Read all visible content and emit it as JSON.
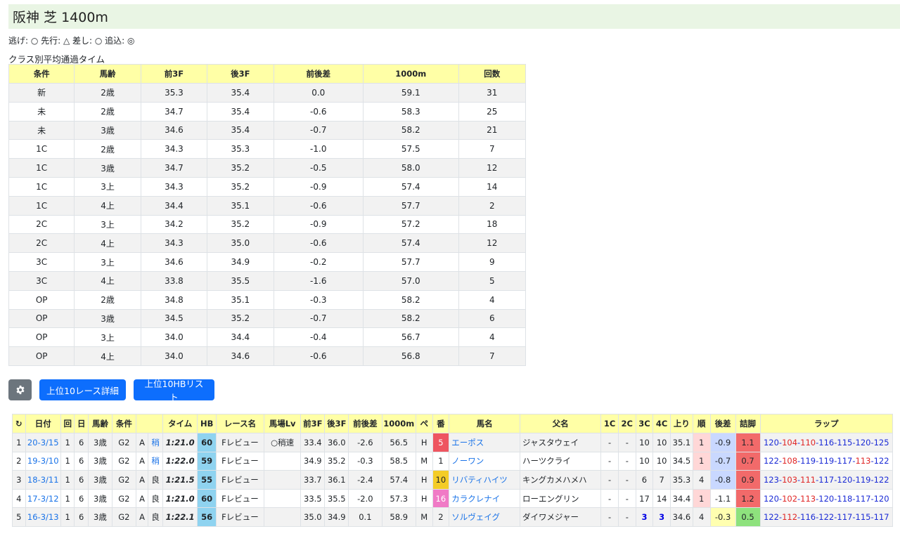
{
  "title": "阪神 芝 1400m",
  "legend": "逃げ: ○ 先行: △ 差し: ○ 追込: ◎",
  "caption": "クラス別平均通過タイム",
  "avg_table": {
    "headers": [
      "条件",
      "馬齢",
      "前3F",
      "後3F",
      "前後差",
      "1000m",
      "回数"
    ],
    "rows": [
      [
        "新",
        "2歳",
        "35.3",
        "35.4",
        "0.0",
        "59.1",
        "31"
      ],
      [
        "未",
        "2歳",
        "34.7",
        "35.4",
        "-0.6",
        "58.3",
        "25"
      ],
      [
        "未",
        "3歳",
        "34.6",
        "35.4",
        "-0.7",
        "58.2",
        "21"
      ],
      [
        "1C",
        "2歳",
        "34.3",
        "35.3",
        "-1.0",
        "57.5",
        "7"
      ],
      [
        "1C",
        "3歳",
        "34.7",
        "35.2",
        "-0.5",
        "58.0",
        "12"
      ],
      [
        "1C",
        "3上",
        "34.3",
        "35.2",
        "-0.9",
        "57.4",
        "14"
      ],
      [
        "1C",
        "4上",
        "34.4",
        "35.1",
        "-0.6",
        "57.7",
        "2"
      ],
      [
        "2C",
        "3上",
        "34.2",
        "35.2",
        "-0.9",
        "57.2",
        "18"
      ],
      [
        "2C",
        "4上",
        "34.3",
        "35.0",
        "-0.6",
        "57.4",
        "12"
      ],
      [
        "3C",
        "3上",
        "34.6",
        "34.9",
        "-0.2",
        "57.7",
        "9"
      ],
      [
        "3C",
        "4上",
        "33.8",
        "35.5",
        "-1.6",
        "57.0",
        "5"
      ],
      [
        "OP",
        "2歳",
        "34.8",
        "35.1",
        "-0.3",
        "58.2",
        "4"
      ],
      [
        "OP",
        "3歳",
        "34.5",
        "35.2",
        "-0.7",
        "58.2",
        "6"
      ],
      [
        "OP",
        "3上",
        "34.0",
        "34.4",
        "-0.4",
        "56.7",
        "4"
      ],
      [
        "OP",
        "4上",
        "34.0",
        "34.6",
        "-0.6",
        "56.8",
        "7"
      ]
    ]
  },
  "buttons": {
    "gear_icon": "gear-icon",
    "detail": "上位10レース詳細",
    "hb_list": "上位10HBリスト"
  },
  "race_table": {
    "refresh_icon": "↻",
    "headers": [
      "日付",
      "回",
      "日",
      "馬齢",
      "条件",
      "",
      "タイム",
      "HB",
      "レース名",
      "馬場Lv",
      "前3F",
      "後3F",
      "前後差",
      "1000m",
      "ペ",
      "番",
      "馬名",
      "父名",
      "1C",
      "2C",
      "3C",
      "4C",
      "上り",
      "順",
      "後差",
      "詰脚",
      "ラップ"
    ],
    "rows": [
      {
        "no": "1",
        "date": "20-3/15",
        "kai": "1",
        "nichi": "6",
        "age": "3歳",
        "cond": "G2",
        "grade": "A",
        "baba": "稍",
        "time": "1:21.0",
        "hb": "60",
        "race": "Fレビュー",
        "lv": "○稍速",
        "f3": "33.4",
        "l3": "36.0",
        "diff": "-2.6",
        "m1000": "56.5",
        "pace": "H",
        "ban": "5",
        "horse": "エーポス",
        "sire": "ジャスタウェイ",
        "c1": "-",
        "c2": "-",
        "c3": "10",
        "c4": "10",
        "agari": "35.1",
        "jun": "1",
        "ato": "-0.9",
        "tsume": "1.1",
        "lap": [
          [
            "120",
            "b"
          ],
          [
            "-",
            "b"
          ],
          [
            "104",
            "r"
          ],
          [
            "-",
            "b"
          ],
          [
            "110",
            "r"
          ],
          [
            "-",
            "b"
          ],
          [
            "116",
            "b"
          ],
          [
            "-",
            "b"
          ],
          [
            "115",
            "b"
          ],
          [
            "-",
            "b"
          ],
          [
            "120",
            "b"
          ],
          [
            "-",
            "b"
          ],
          [
            "125",
            "b"
          ]
        ]
      },
      {
        "no": "2",
        "date": "19-3/10",
        "kai": "1",
        "nichi": "6",
        "age": "3歳",
        "cond": "G2",
        "grade": "A",
        "baba": "稍",
        "time": "1:22.0",
        "hb": "59",
        "race": "Fレビュー",
        "lv": "",
        "f3": "34.9",
        "l3": "35.2",
        "diff": "-0.3",
        "m1000": "58.5",
        "pace": "M",
        "ban": "1",
        "horse": "ノーワン",
        "sire": "ハーツクライ",
        "c1": "-",
        "c2": "-",
        "c3": "10",
        "c4": "10",
        "agari": "34.5",
        "jun": "1",
        "ato": "-0.7",
        "tsume": "0.7",
        "lap": [
          [
            "122",
            "b"
          ],
          [
            "-",
            "b"
          ],
          [
            "108",
            "r"
          ],
          [
            "-",
            "b"
          ],
          [
            "119",
            "b"
          ],
          [
            "-",
            "b"
          ],
          [
            "119",
            "b"
          ],
          [
            "-",
            "b"
          ],
          [
            "117",
            "b"
          ],
          [
            "-",
            "b"
          ],
          [
            "113",
            "r"
          ],
          [
            "-",
            "b"
          ],
          [
            "122",
            "b"
          ]
        ]
      },
      {
        "no": "3",
        "date": "18-3/11",
        "kai": "1",
        "nichi": "6",
        "age": "3歳",
        "cond": "G2",
        "grade": "A",
        "baba": "良",
        "time": "1:21.5",
        "hb": "55",
        "race": "Fレビュー",
        "lv": "",
        "f3": "33.7",
        "l3": "36.1",
        "diff": "-2.4",
        "m1000": "57.4",
        "pace": "H",
        "ban": "10",
        "horse": "リバティハイツ",
        "sire": "キングカメハメハ",
        "c1": "-",
        "c2": "-",
        "c3": "6",
        "c4": "7",
        "agari": "35.3",
        "jun": "4",
        "ato": "-0.8",
        "tsume": "0.9",
        "lap": [
          [
            "123",
            "b"
          ],
          [
            "-",
            "b"
          ],
          [
            "103",
            "r"
          ],
          [
            "-",
            "b"
          ],
          [
            "111",
            "r"
          ],
          [
            "-",
            "b"
          ],
          [
            "117",
            "b"
          ],
          [
            "-",
            "b"
          ],
          [
            "120",
            "b"
          ],
          [
            "-",
            "b"
          ],
          [
            "119",
            "b"
          ],
          [
            "-",
            "b"
          ],
          [
            "122",
            "b"
          ]
        ]
      },
      {
        "no": "4",
        "date": "17-3/12",
        "kai": "1",
        "nichi": "6",
        "age": "3歳",
        "cond": "G2",
        "grade": "A",
        "baba": "良",
        "time": "1:21.0",
        "hb": "60",
        "race": "Fレビュー",
        "lv": "",
        "f3": "33.5",
        "l3": "35.5",
        "diff": "-2.0",
        "m1000": "57.3",
        "pace": "H",
        "ban": "16",
        "horse": "カラクレナイ",
        "sire": "ローエングリン",
        "c1": "-",
        "c2": "-",
        "c3": "17",
        "c4": "14",
        "agari": "34.4",
        "jun": "1",
        "ato": "-1.1",
        "tsume": "1.2",
        "lap": [
          [
            "120",
            "b"
          ],
          [
            "-",
            "b"
          ],
          [
            "102",
            "r"
          ],
          [
            "-",
            "b"
          ],
          [
            "113",
            "r"
          ],
          [
            "-",
            "b"
          ],
          [
            "120",
            "b"
          ],
          [
            "-",
            "b"
          ],
          [
            "118",
            "b"
          ],
          [
            "-",
            "b"
          ],
          [
            "117",
            "b"
          ],
          [
            "-",
            "b"
          ],
          [
            "120",
            "b"
          ]
        ]
      },
      {
        "no": "5",
        "date": "16-3/13",
        "kai": "1",
        "nichi": "6",
        "age": "3歳",
        "cond": "G2",
        "grade": "A",
        "baba": "良",
        "time": "1:22.1",
        "hb": "56",
        "race": "Fレビュー",
        "lv": "",
        "f3": "35.0",
        "l3": "34.9",
        "diff": "0.1",
        "m1000": "58.9",
        "pace": "M",
        "ban": "2",
        "horse": "ソルヴェイグ",
        "sire": "ダイワメジャー",
        "c1": "-",
        "c2": "-",
        "c3": "3",
        "c4": "3",
        "agari": "34.6",
        "jun": "4",
        "ato": "-0.3",
        "tsume": "0.5",
        "lap": [
          [
            "122",
            "b"
          ],
          [
            "-",
            "b"
          ],
          [
            "112",
            "r"
          ],
          [
            "-",
            "b"
          ],
          [
            "116",
            "b"
          ],
          [
            "-",
            "b"
          ],
          [
            "122",
            "b"
          ],
          [
            "-",
            "b"
          ],
          [
            "117",
            "b"
          ],
          [
            "-",
            "b"
          ],
          [
            "115",
            "b"
          ],
          [
            "-",
            "b"
          ],
          [
            "117",
            "b"
          ]
        ]
      }
    ]
  }
}
